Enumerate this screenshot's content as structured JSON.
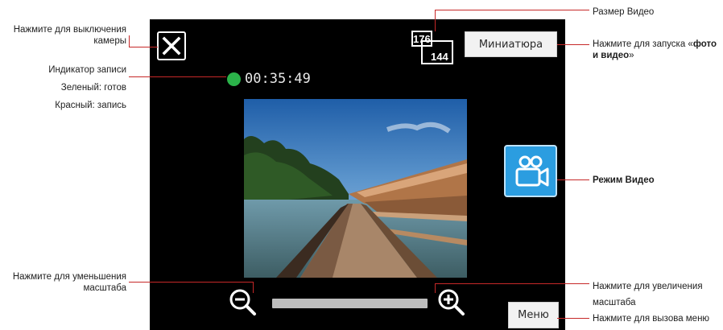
{
  "recording": {
    "time": "00:35:49",
    "status_color": "#2bb34a"
  },
  "buttons": {
    "thumbnail_label": "Миниатюра",
    "menu_label": "Меню"
  },
  "resolution": {
    "top": "176",
    "bottom": "144"
  },
  "colors": {
    "screen_bg": "#000000",
    "accent_blue": "#2b9de0",
    "leader_line": "#c62828",
    "rec_green": "#2bb34a"
  },
  "icons": {
    "close": "close-icon",
    "video": "video-camera-icon",
    "zoom_out": "zoom-out-icon",
    "zoom_in": "zoom-in-icon",
    "resolution": "resolution-icon"
  },
  "zoom": {
    "level": 0.0
  },
  "annotations": {
    "camera_off": "Нажмите для выключения камеры",
    "rec_indicator": "Индикатор записи",
    "green_ready": "Зеленый: готов",
    "red_recording": "Красный: запись",
    "zoom_out": "Нажмите для уменьшения масштаба",
    "video_size": "Размер Видео",
    "launch_prefix": "Нажмите для запуска «",
    "launch_bold": "фото и видео",
    "launch_suffix": "»",
    "video_mode": "Режим Видео",
    "zoom_in": "Нажмите для увеличения масштаба",
    "menu_call": "Нажмите для вызова меню"
  }
}
